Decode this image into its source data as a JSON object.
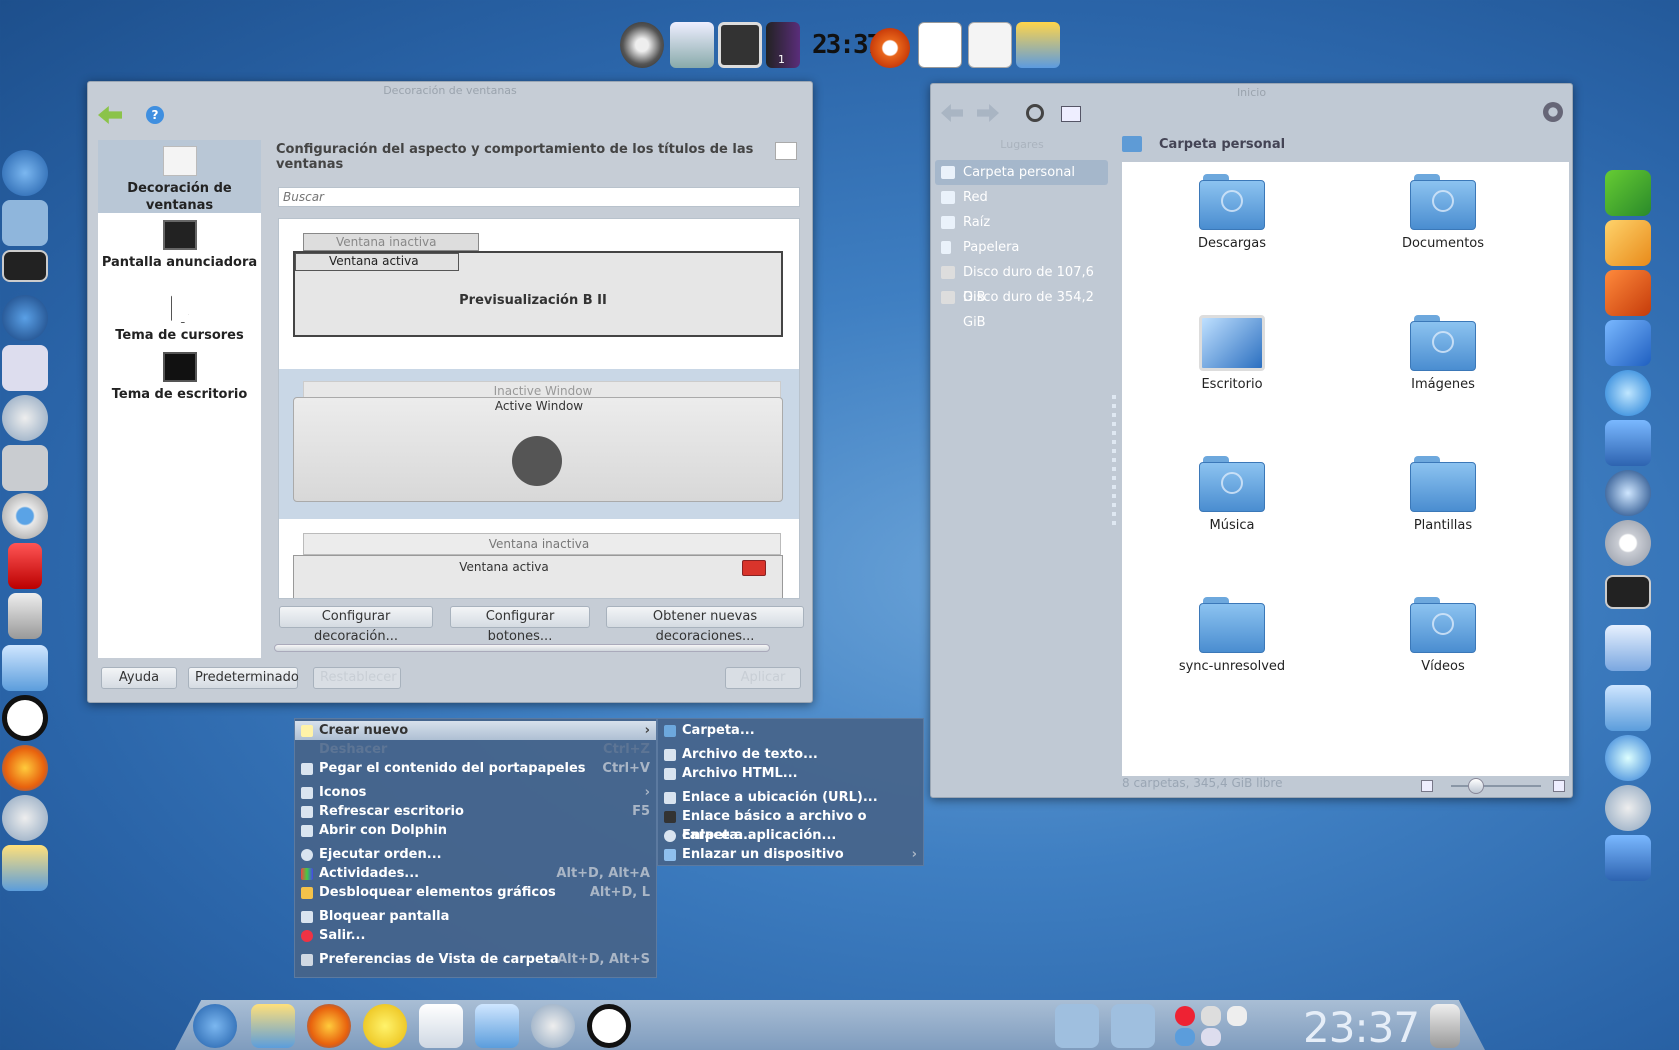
{
  "top_dock": {
    "clock": "23:37",
    "workspace_badge": "1"
  },
  "deco_window": {
    "title": "Decoración de ventanas",
    "header": "Configuración del aspecto y comportamiento de los títulos de las ventanas",
    "search_placeholder": "Buscar",
    "categories": [
      {
        "label": "Decoración de ventanas",
        "icon": "window-decoration-icon"
      },
      {
        "label": "Pantalla anunciadora",
        "icon": "splash-screen-icon"
      },
      {
        "label": "Tema de cursores",
        "icon": "cursor-icon"
      },
      {
        "label": "Tema de escritorio",
        "icon": "desktop-theme-icon"
      }
    ],
    "preview1": {
      "inactive": "Ventana inactiva",
      "active": "Ventana activa",
      "name": "Previsualización B II"
    },
    "preview2": {
      "inactive": "Inactive Window",
      "active": "Active Window"
    },
    "preview3": {
      "inactive": "Ventana inactiva",
      "active": "Ventana activa"
    },
    "buttons": {
      "configure_deco": "Configurar decoración...",
      "configure_buttons": "Configurar botones...",
      "get_new": "Obtener nuevas decoraciones...",
      "help": "Ayuda",
      "defaults": "Predeterminado",
      "reset": "Restablecer",
      "apply": "Aplicar"
    }
  },
  "dolphin": {
    "title": "Inicio",
    "places_title": "Lugares",
    "places": [
      {
        "label": "Carpeta personal",
        "selected": true
      },
      {
        "label": "Red"
      },
      {
        "label": "Raíz"
      },
      {
        "label": "Papelera"
      },
      {
        "label": "Disco duro de 107,6 GiB"
      },
      {
        "label": "Disco duro de 354,2 GiB"
      }
    ],
    "breadcrumb": "Carpeta personal",
    "folders": [
      "Descargas",
      "Documentos",
      "Escritorio",
      "Imágenes",
      "Música",
      "Plantillas",
      "sync-unresolved",
      "Vídeos"
    ],
    "status": "8 carpetas, 345,4 GiB libre"
  },
  "context_menu": {
    "items": [
      {
        "label": "Crear nuevo",
        "shortcut": "",
        "submenu": true
      },
      {
        "label": "Deshacer",
        "shortcut": "Ctrl+Z",
        "disabled": true
      },
      {
        "label": "Pegar el contenido del portapapeles",
        "shortcut": "Ctrl+V"
      },
      {
        "label": "Iconos",
        "shortcut": "",
        "submenu": true
      },
      {
        "label": "Refrescar escritorio",
        "shortcut": "F5"
      },
      {
        "label": "Abrir con Dolphin",
        "shortcut": ""
      },
      {
        "label": "Ejecutar orden...",
        "shortcut": ""
      },
      {
        "label": "Actividades...",
        "shortcut": "Alt+D, Alt+A"
      },
      {
        "label": "Desbloquear elementos gráficos",
        "shortcut": "Alt+D, L"
      },
      {
        "label": "Bloquear pantalla",
        "shortcut": ""
      },
      {
        "label": "Salir...",
        "shortcut": ""
      },
      {
        "label": "Preferencias de Vista de carpeta",
        "shortcut": "Alt+D, Alt+S"
      }
    ],
    "submenu": [
      {
        "label": "Carpeta..."
      },
      {
        "label": "Archivo de texto..."
      },
      {
        "label": "Archivo HTML..."
      },
      {
        "label": "Enlace a ubicación (URL)..."
      },
      {
        "label": "Enlace básico a archivo o carpeta..."
      },
      {
        "label": "Enlace a aplicación..."
      },
      {
        "label": "Enlazar un dispositivo",
        "submenu": true
      }
    ]
  },
  "panel": {
    "clock": "23:37"
  }
}
